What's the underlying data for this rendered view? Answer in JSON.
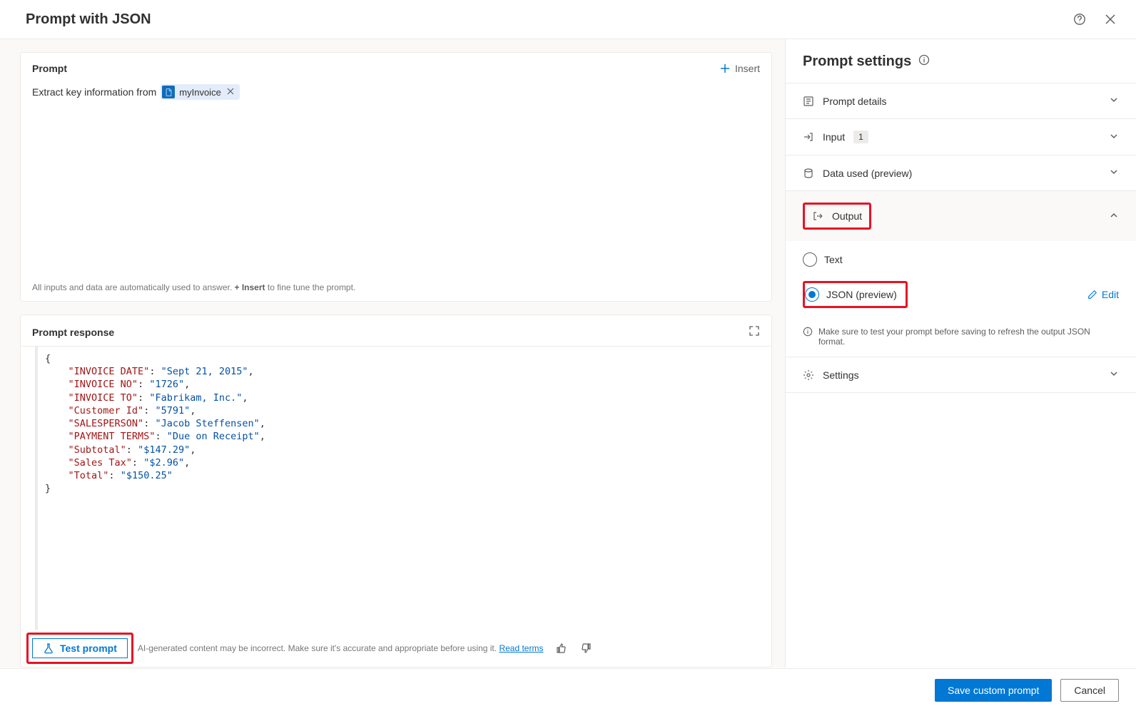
{
  "header": {
    "title": "Prompt with JSON"
  },
  "prompt_panel": {
    "title": "Prompt",
    "insert_label": "Insert",
    "text_prefix": "Extract key information from",
    "chip_label": "myInvoice",
    "footer_prefix": "All inputs and data are automatically used to answer. ",
    "footer_bold": "+ Insert",
    "footer_suffix": " to fine tune the prompt."
  },
  "response_panel": {
    "title": "Prompt response",
    "json": [
      {
        "k": "INVOICE DATE",
        "v": "Sept 21, 2015"
      },
      {
        "k": "INVOICE NO",
        "v": "1726"
      },
      {
        "k": "INVOICE TO",
        "v": "Fabrikam, Inc."
      },
      {
        "k": "Customer Id",
        "v": "5791"
      },
      {
        "k": "SALESPERSON",
        "v": "Jacob Steffensen"
      },
      {
        "k": "PAYMENT TERMS",
        "v": "Due on Receipt"
      },
      {
        "k": "Subtotal",
        "v": "$147.29"
      },
      {
        "k": "Sales Tax",
        "v": "$2.96"
      },
      {
        "k": "Total",
        "v": "$150.25"
      }
    ],
    "test_label": "Test prompt",
    "disclaimer_text": "AI-generated content may be incorrect. Make sure it's accurate and appropriate before using it.",
    "read_terms": "Read terms"
  },
  "settings": {
    "title": "Prompt settings",
    "items": {
      "details": "Prompt details",
      "input": "Input",
      "input_badge": "1",
      "data": "Data used (preview)",
      "output": "Output",
      "text_option": "Text",
      "json_option": "JSON (preview)",
      "edit": "Edit",
      "info": "Make sure to test your prompt before saving to refresh the output JSON format.",
      "settings": "Settings"
    }
  },
  "footer": {
    "save": "Save custom prompt",
    "cancel": "Cancel"
  }
}
